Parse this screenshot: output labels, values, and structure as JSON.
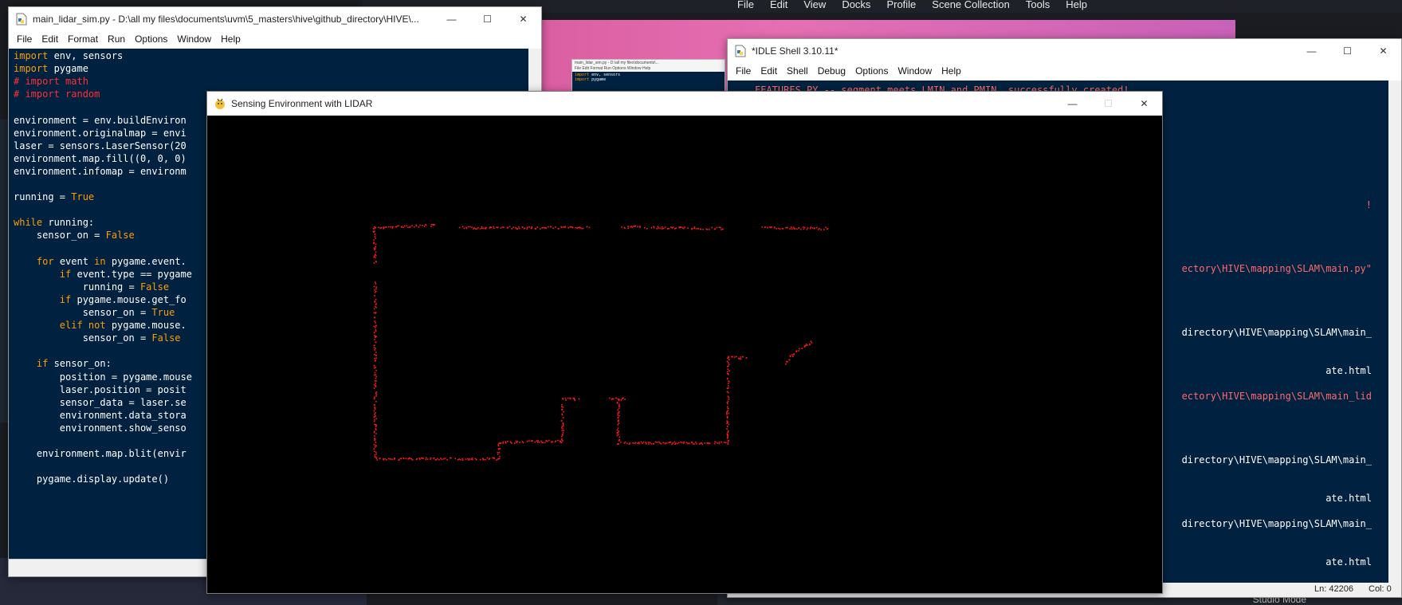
{
  "obs_menu": [
    "File",
    "Edit",
    "View",
    "Docks",
    "Profile",
    "Scene Collection",
    "Tools",
    "Help"
  ],
  "obs_status": "Studio Mode",
  "editor": {
    "title": "main_lidar_sim.py - D:\\all my files\\documents\\uvm\\5_masters\\hive\\github_directory\\HIVE\\...",
    "menu": [
      "File",
      "Edit",
      "Format",
      "Run",
      "Options",
      "Window",
      "Help"
    ],
    "lines": [
      [
        {
          "t": "import",
          "c": "kw"
        },
        {
          "t": " env, sensors"
        }
      ],
      [
        {
          "t": "import",
          "c": "kw"
        },
        {
          "t": " pygame"
        }
      ],
      [
        {
          "t": "# import math",
          "c": "cm"
        }
      ],
      [
        {
          "t": "# import random",
          "c": "cm"
        }
      ],
      [],
      [
        {
          "t": "environment = env.buildEnviron"
        }
      ],
      [
        {
          "t": "environment.originalmap = envi"
        }
      ],
      [
        {
          "t": "laser = sensors.LaserSensor(20"
        }
      ],
      [
        {
          "t": "environment.map.fill((0, 0, 0)"
        }
      ],
      [
        {
          "t": "environment.infomap = environm"
        }
      ],
      [],
      [
        {
          "t": "running = "
        },
        {
          "t": "True",
          "c": "kw"
        }
      ],
      [],
      [
        {
          "t": "while",
          "c": "kw"
        },
        {
          "t": " running:"
        }
      ],
      [
        {
          "t": "    sensor_on = "
        },
        {
          "t": "False",
          "c": "kw"
        }
      ],
      [],
      [
        {
          "t": "    "
        },
        {
          "t": "for",
          "c": "kw"
        },
        {
          "t": " event "
        },
        {
          "t": "in",
          "c": "kw"
        },
        {
          "t": " pygame.event."
        }
      ],
      [
        {
          "t": "        "
        },
        {
          "t": "if",
          "c": "kw"
        },
        {
          "t": " event.type == pygame"
        }
      ],
      [
        {
          "t": "            running = "
        },
        {
          "t": "False",
          "c": "kw"
        }
      ],
      [
        {
          "t": "        "
        },
        {
          "t": "if",
          "c": "kw"
        },
        {
          "t": " pygame.mouse.get_fo"
        }
      ],
      [
        {
          "t": "            sensor_on = "
        },
        {
          "t": "True",
          "c": "kw"
        }
      ],
      [
        {
          "t": "        "
        },
        {
          "t": "elif not",
          "c": "kw"
        },
        {
          "t": " pygame.mouse."
        }
      ],
      [
        {
          "t": "            sensor_on = "
        },
        {
          "t": "False",
          "c": "kw"
        }
      ],
      [],
      [
        {
          "t": "    "
        },
        {
          "t": "if",
          "c": "kw"
        },
        {
          "t": " sensor_on:"
        }
      ],
      [
        {
          "t": "        position = pygame.mouse"
        }
      ],
      [
        {
          "t": "        laser.position = posit"
        }
      ],
      [
        {
          "t": "        sensor_data = laser.se"
        }
      ],
      [
        {
          "t": "        environment.data_stora"
        }
      ],
      [
        {
          "t": "        environment.show_senso"
        }
      ],
      [],
      [
        {
          "t": "    environment.map.blit(envir"
        }
      ],
      [],
      [
        {
          "t": "    pygame.display.update()"
        }
      ]
    ]
  },
  "shell": {
    "title": "*IDLE Shell 3.10.11*",
    "menu": [
      "File",
      "Edit",
      "Shell",
      "Debug",
      "Options",
      "Window",
      "Help"
    ],
    "first_line": "FEATURES.PY -- segment meets LMIN and PMIN, successfully created!",
    "right_lines": [
      {
        "text": "!",
        "row": 9,
        "color": "#ff6a6a"
      },
      {
        "text": "ectory\\HIVE\\mapping\\SLAM\\main.py\"",
        "row": 14,
        "color": "#ff6a6a"
      },
      {
        "text": "directory\\HIVE\\mapping\\SLAM\\main_",
        "row": 19,
        "color": "#ffffff"
      },
      {
        "text": "ate.html",
        "row": 22,
        "color": "#ffffff"
      },
      {
        "text": "ectory\\HIVE\\mapping\\SLAM\\main_lid",
        "row": 24,
        "color": "#ff6a6a"
      },
      {
        "text": "directory\\HIVE\\mapping\\SLAM\\main_",
        "row": 29,
        "color": "#ffffff"
      },
      {
        "text": "ate.html",
        "row": 32,
        "color": "#ffffff"
      },
      {
        "text": "directory\\HIVE\\mapping\\SLAM\\main_",
        "row": 34,
        "color": "#ffffff"
      },
      {
        "text": "ate.html",
        "row": 37,
        "color": "#ffffff"
      }
    ],
    "status": {
      "ln": "Ln: 42206",
      "col": "Col: 0"
    }
  },
  "pygame": {
    "title": "Sensing Environment with LIDAR"
  },
  "lidar_map": {
    "point_color": "#ff1a1a",
    "segments": [
      [
        [
          469,
          285
        ],
        [
          547,
          282
        ]
      ],
      [
        [
          577,
          285
        ],
        [
          738,
          285
        ]
      ],
      [
        [
          778,
          284
        ],
        [
          906,
          286
        ]
      ],
      [
        [
          956,
          285
        ],
        [
          1038,
          286
        ]
      ],
      [
        [
          469,
          285
        ],
        [
          470,
          330
        ]
      ],
      [
        [
          470,
          355
        ],
        [
          470,
          575
        ]
      ],
      [
        [
          470,
          575
        ],
        [
          625,
          575
        ]
      ],
      [
        [
          625,
          575
        ],
        [
          625,
          555
        ]
      ],
      [
        [
          625,
          554
        ],
        [
          705,
          553
        ]
      ],
      [
        [
          705,
          553
        ],
        [
          705,
          505
        ]
      ],
      [
        [
          704,
          500
        ],
        [
          725,
          500
        ]
      ],
      [
        [
          765,
          500
        ],
        [
          784,
          500
        ]
      ],
      [
        [
          775,
          500
        ],
        [
          775,
          555
        ]
      ],
      [
        [
          775,
          555
        ],
        [
          912,
          555
        ]
      ],
      [
        [
          912,
          555
        ],
        [
          913,
          448
        ]
      ],
      [
        [
          913,
          448
        ],
        [
          937,
          448
        ]
      ],
      [
        [
          990,
          447
        ],
        [
          1018,
          428
        ]
      ],
      [
        [
          985,
          455
        ],
        [
          990,
          450
        ]
      ]
    ]
  }
}
